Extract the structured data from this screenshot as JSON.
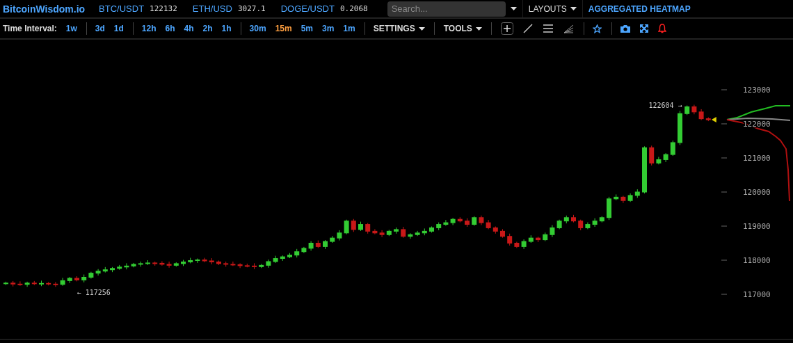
{
  "header": {
    "logo": "BitcoinWisdom.io",
    "tickers": [
      {
        "symbol": "BTC/USDT",
        "price": "122132"
      },
      {
        "symbol": "ETH/USD",
        "price": "3027.1"
      },
      {
        "symbol": "DOGE/USDT",
        "price": "0.2068"
      }
    ],
    "search": {
      "placeholder": "Search..."
    },
    "layouts": "LAYOUTS",
    "heatmap_link": "AGGREGATED HEATMAP"
  },
  "toolbar": {
    "label": "Time Interval:",
    "interval_groups": [
      [
        {
          "label": "1w",
          "selected": false
        }
      ],
      [
        {
          "label": "3d",
          "selected": false
        },
        {
          "label": "1d",
          "selected": false
        }
      ],
      [
        {
          "label": "12h",
          "selected": false
        },
        {
          "label": "6h",
          "selected": false
        },
        {
          "label": "4h",
          "selected": false
        },
        {
          "label": "2h",
          "selected": false
        },
        {
          "label": "1h",
          "selected": false
        }
      ],
      [
        {
          "label": "30m",
          "selected": false
        },
        {
          "label": "15m",
          "selected": true
        },
        {
          "label": "5m",
          "selected": false
        },
        {
          "label": "3m",
          "selected": false
        },
        {
          "label": "1m",
          "selected": false
        }
      ]
    ],
    "settings": "SETTINGS",
    "tools": "TOOLS"
  },
  "chart": {
    "high_label": "122604 →",
    "low_label": "← 117256",
    "chart_data": {
      "type": "candlestick",
      "ylim": [
        117000,
        123000
      ],
      "yticks": [
        {
          "value": 117000,
          "label": "117000"
        },
        {
          "value": 118000,
          "label": "118000"
        },
        {
          "value": 119000,
          "label": "119000"
        },
        {
          "value": 120000,
          "label": "120000"
        },
        {
          "value": 121000,
          "label": "121000"
        },
        {
          "value": 122000,
          "label": "122000"
        },
        {
          "value": 123000,
          "label": "123000"
        }
      ],
      "categories": [
        null,
        null,
        null,
        null,
        null,
        null,
        null,
        null,
        null,
        null,
        null,
        null,
        null,
        null,
        null,
        null,
        null,
        null,
        null,
        null,
        null,
        null,
        null,
        null,
        null,
        null,
        null,
        null,
        null,
        null,
        null,
        null,
        null,
        null,
        null,
        null,
        null,
        null,
        null,
        null,
        null,
        null,
        null,
        null,
        null,
        null,
        null,
        null,
        null,
        null,
        null,
        null,
        null,
        null,
        null,
        null,
        null,
        null,
        null,
        null,
        null,
        null,
        null,
        null,
        null,
        null,
        null,
        null,
        null,
        null,
        null,
        null,
        null,
        null,
        null,
        null,
        null,
        null,
        null,
        null,
        null,
        null,
        null,
        null,
        null,
        null,
        null,
        null,
        null,
        null,
        null,
        null,
        null,
        null,
        null,
        null,
        null,
        null,
        null,
        null
      ],
      "ohlc": [
        [
          117310,
          117370,
          117270,
          117330
        ],
        [
          117330,
          117390,
          117230,
          117300
        ],
        [
          117300,
          117380,
          117250,
          117290
        ],
        [
          117290,
          117370,
          117220,
          117330
        ],
        [
          117330,
          117390,
          117270,
          117310
        ],
        [
          117310,
          117400,
          117240,
          117320
        ],
        [
          117320,
          117360,
          117260,
          117300
        ],
        [
          117300,
          117360,
          117220,
          117290
        ],
        [
          117290,
          117480,
          117250,
          117400
        ],
        [
          117400,
          117510,
          117330,
          117470
        ],
        [
          117470,
          117530,
          117380,
          117420
        ],
        [
          117420,
          117580,
          117350,
          117500
        ],
        [
          117500,
          117660,
          117460,
          117620
        ],
        [
          117620,
          117740,
          117550,
          117680
        ],
        [
          117680,
          117800,
          117640,
          117720
        ],
        [
          117720,
          117800,
          117650,
          117760
        ],
        [
          117760,
          117860,
          117720,
          117800
        ],
        [
          117800,
          117910,
          117730,
          117830
        ],
        [
          117830,
          117920,
          117790,
          117880
        ],
        [
          117880,
          117960,
          117810,
          117900
        ],
        [
          117900,
          118000,
          117860,
          117920
        ],
        [
          117920,
          117960,
          117840,
          117910
        ],
        [
          117910,
          117970,
          117840,
          117880
        ],
        [
          117880,
          117960,
          117780,
          117850
        ],
        [
          117850,
          117940,
          117810,
          117900
        ],
        [
          117900,
          118010,
          117830,
          117950
        ],
        [
          117950,
          118070,
          117910,
          117990
        ],
        [
          117990,
          118050,
          117920,
          118010
        ],
        [
          118010,
          118070,
          117940,
          117980
        ],
        [
          117980,
          118060,
          117880,
          117950
        ],
        [
          117950,
          117990,
          117860,
          117900
        ],
        [
          117900,
          117960,
          117810,
          117880
        ],
        [
          117880,
          117960,
          117830,
          117870
        ],
        [
          117870,
          117910,
          117770,
          117840
        ],
        [
          117840,
          117900,
          117790,
          117830
        ],
        [
          117830,
          117910,
          117740,
          117810
        ],
        [
          117810,
          117890,
          117770,
          117850
        ],
        [
          117850,
          118020,
          117780,
          117960
        ],
        [
          117960,
          118130,
          117920,
          118050
        ],
        [
          118050,
          118140,
          117980,
          118100
        ],
        [
          118100,
          118210,
          118060,
          118150
        ],
        [
          118150,
          118330,
          118080,
          118250
        ],
        [
          118250,
          118390,
          118210,
          118350
        ],
        [
          118350,
          118560,
          118280,
          118500
        ],
        [
          118500,
          118580,
          118360,
          118400
        ],
        [
          118400,
          118590,
          118330,
          118550
        ],
        [
          118550,
          118710,
          118510,
          118650
        ],
        [
          118650,
          118880,
          118580,
          118800
        ],
        [
          118800,
          119190,
          118760,
          119150
        ],
        [
          119150,
          119210,
          118830,
          118900
        ],
        [
          118900,
          119130,
          118860,
          119050
        ],
        [
          119050,
          119090,
          118780,
          118850
        ],
        [
          118850,
          118910,
          118760,
          118800
        ],
        [
          118800,
          118880,
          118680,
          118750
        ],
        [
          118750,
          118890,
          118710,
          118850
        ],
        [
          118850,
          118960,
          118780,
          118900
        ],
        [
          118900,
          118980,
          118660,
          118700
        ],
        [
          118700,
          118790,
          118630,
          118750
        ],
        [
          118750,
          118860,
          118710,
          118800
        ],
        [
          118800,
          118930,
          118730,
          118850
        ],
        [
          118850,
          118990,
          118810,
          118950
        ],
        [
          118950,
          119110,
          118880,
          119050
        ],
        [
          119050,
          119180,
          119010,
          119100
        ],
        [
          119100,
          119240,
          119030,
          119200
        ],
        [
          119200,
          119260,
          119110,
          119150
        ],
        [
          119150,
          119230,
          118980,
          119050
        ],
        [
          119050,
          119290,
          119010,
          119250
        ],
        [
          119250,
          119310,
          119030,
          119100
        ],
        [
          119100,
          119180,
          118910,
          118950
        ],
        [
          118950,
          118990,
          118780,
          118850
        ],
        [
          118850,
          118910,
          118660,
          118700
        ],
        [
          118700,
          118780,
          118430,
          118500
        ],
        [
          118500,
          118540,
          118360,
          118400
        ],
        [
          118400,
          118610,
          118330,
          118550
        ],
        [
          118550,
          118730,
          118510,
          118650
        ],
        [
          118650,
          118690,
          118530,
          118600
        ],
        [
          118600,
          118810,
          118560,
          118750
        ],
        [
          118750,
          119030,
          118680,
          118950
        ],
        [
          118950,
          119190,
          118910,
          119150
        ],
        [
          119150,
          119310,
          119080,
          119250
        ],
        [
          119250,
          119330,
          119110,
          119150
        ],
        [
          119150,
          119190,
          118880,
          118950
        ],
        [
          118950,
          119110,
          118910,
          119050
        ],
        [
          119050,
          119230,
          118980,
          119150
        ],
        [
          119150,
          119290,
          119110,
          119250
        ],
        [
          119250,
          119860,
          119180,
          119800
        ],
        [
          119800,
          119930,
          119760,
          119850
        ],
        [
          119850,
          119890,
          119680,
          119750
        ],
        [
          119750,
          119960,
          119710,
          119900
        ],
        [
          119900,
          120080,
          119830,
          120000
        ],
        [
          120000,
          121340,
          119960,
          121300
        ],
        [
          121300,
          121360,
          120780,
          120850
        ],
        [
          120850,
          121030,
          120810,
          120950
        ],
        [
          120950,
          121140,
          120880,
          121100
        ],
        [
          121100,
          121510,
          121060,
          121450
        ],
        [
          121450,
          122380,
          121380,
          122300
        ],
        [
          122300,
          122540,
          122260,
          122500
        ],
        [
          122500,
          122560,
          122280,
          122350
        ],
        [
          122350,
          122430,
          122110,
          122150
        ],
        [
          122150,
          122190,
          122080,
          122120
        ]
      ]
    }
  }
}
